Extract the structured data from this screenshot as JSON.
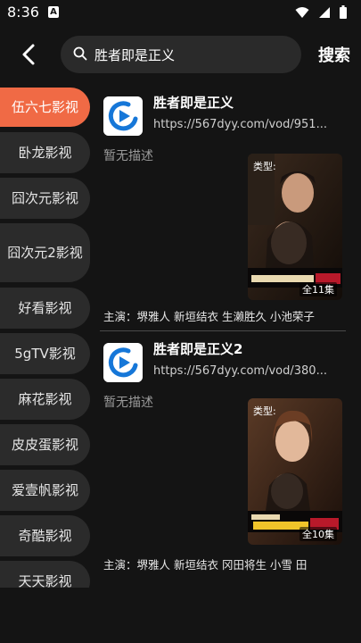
{
  "status_bar": {
    "time": "8:36",
    "notification": "A"
  },
  "search": {
    "query": "胜者即是正义",
    "button_label": "搜索"
  },
  "sidebar": {
    "items": [
      {
        "label": "伍六七影视",
        "active": true
      },
      {
        "label": "卧龙影视",
        "active": false
      },
      {
        "label": "囧次元影视",
        "active": false
      },
      {
        "label": "囧次元2影视",
        "active": false
      },
      {
        "label": "好看影视",
        "active": false
      },
      {
        "label": "5gTV影视",
        "active": false
      },
      {
        "label": "麻花影视",
        "active": false
      },
      {
        "label": "皮皮蛋影视",
        "active": false
      },
      {
        "label": "爱壹帆影视",
        "active": false
      },
      {
        "label": "奇酷影视",
        "active": false
      },
      {
        "label": "天天影视",
        "active": false
      }
    ]
  },
  "results": [
    {
      "title": "胜者即是正义",
      "url": "https://567dyy.com/vod/951...",
      "description": "暂无描述",
      "poster_type_label": "类型:",
      "episode_count": "全11集",
      "cast": "主演：堺雅人 新垣结衣 生濑胜久 小池荣子"
    },
    {
      "title": "胜者即是正义2",
      "url": "https://567dyy.com/vod/380...",
      "description": "暂无描述",
      "poster_type_label": "类型:",
      "episode_count": "全10集",
      "cast": "主演：堺雅人 新垣结衣 冈田将生 小雪 田"
    }
  ],
  "colors": {
    "accent": "#f06a45",
    "background": "#141414",
    "sidebar_item": "#2b2b2b",
    "logo_blue": "#1677d8"
  }
}
